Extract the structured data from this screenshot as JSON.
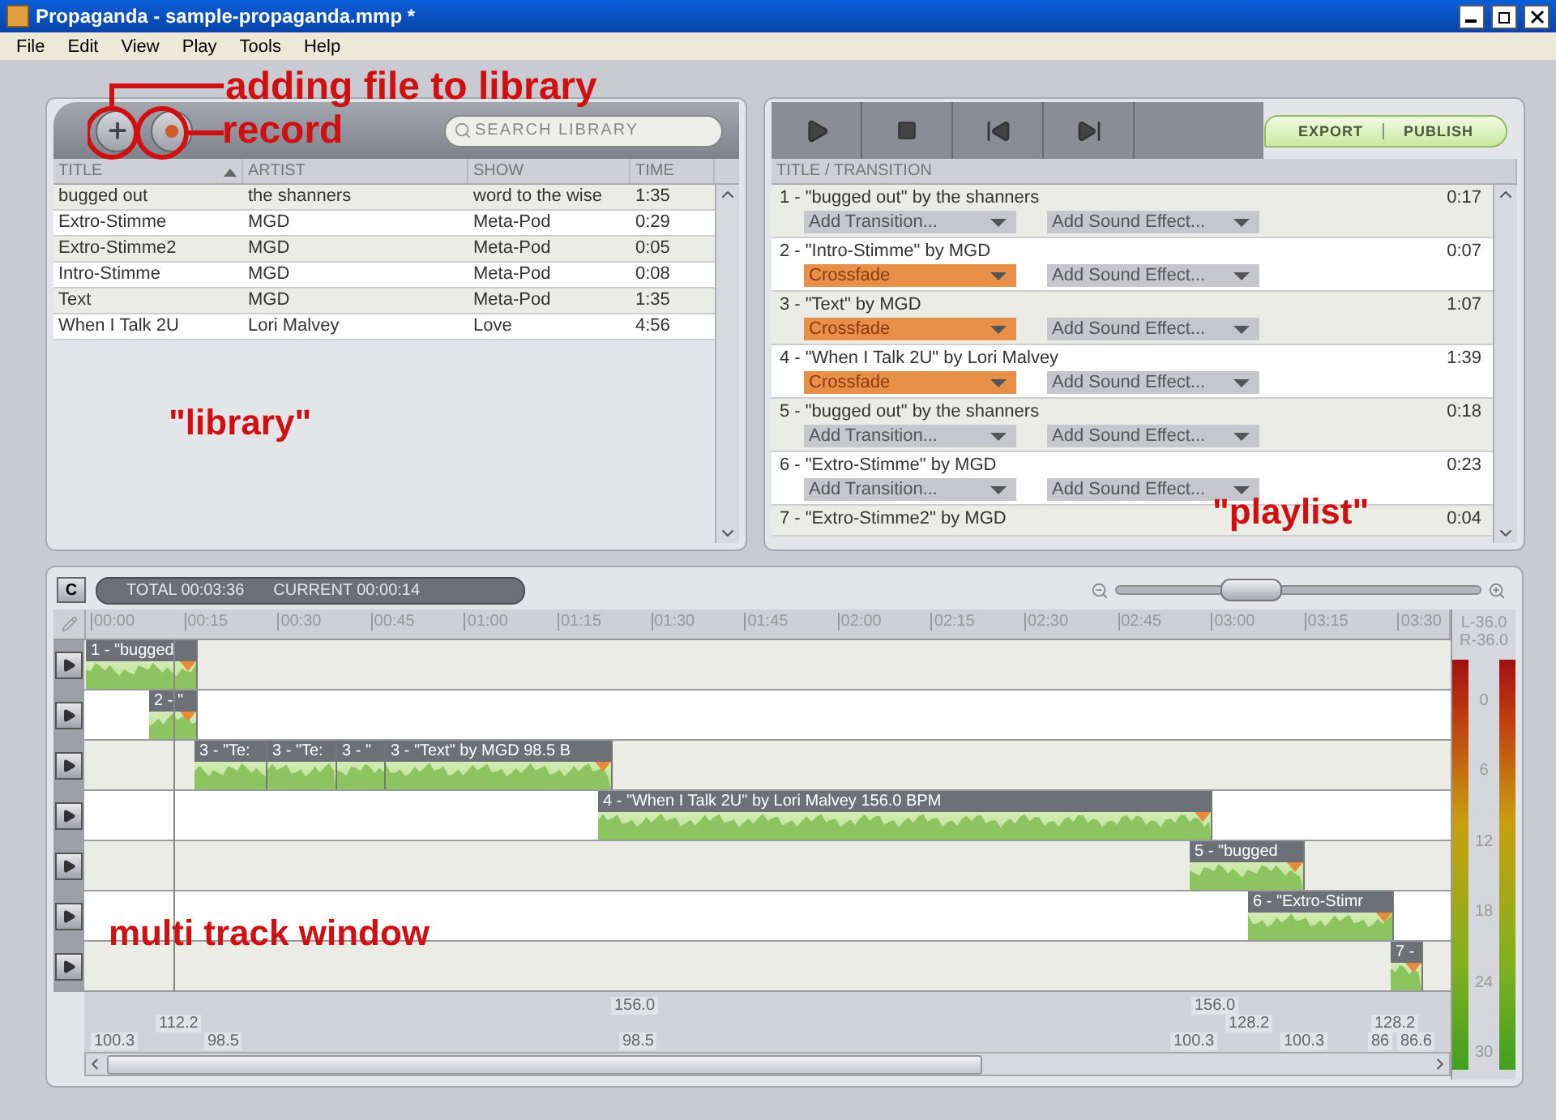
{
  "window": {
    "title": "Propaganda - sample-propaganda.mmp *"
  },
  "menu": [
    "File",
    "Edit",
    "View",
    "Play",
    "Tools",
    "Help"
  ],
  "annotations": [
    {
      "kind": "callout",
      "text": "adding file to library"
    },
    {
      "kind": "callout",
      "text": "record"
    },
    {
      "kind": "label",
      "text": "\"library\""
    },
    {
      "kind": "label",
      "text": "\"playlist\""
    },
    {
      "kind": "label",
      "text": "multi track window"
    }
  ],
  "library": {
    "search": {
      "placeholder": "SEARCH LIBRARY"
    },
    "columns": [
      {
        "label": "TITLE",
        "sorted": true
      },
      {
        "label": "ARTIST",
        "sorted": false
      },
      {
        "label": "SHOW",
        "sorted": false
      },
      {
        "label": "TIME",
        "sorted": false
      }
    ],
    "rows": [
      [
        "bugged out",
        "the shanners",
        "word to the wise",
        "1:35"
      ],
      [
        "Extro-Stimme",
        "MGD",
        "Meta-Pod",
        "0:29"
      ],
      [
        "Extro-Stimme2",
        "MGD",
        "Meta-Pod",
        "0:05"
      ],
      [
        "Intro-Stimme",
        "MGD",
        "Meta-Pod",
        "0:08"
      ],
      [
        "Text",
        "MGD",
        "Meta-Pod",
        "1:35"
      ],
      [
        "When I Talk 2U",
        "Lori Malvey",
        "Love",
        "4:56"
      ]
    ]
  },
  "playlist": {
    "export": "EXPORT",
    "publish": "PUBLISH",
    "column": "TITLE / TRANSITION",
    "items": [
      {
        "title": "1 - \"bugged out\" by the shanners",
        "time": "0:17",
        "transition": {
          "label": "Add Transition...",
          "set": false
        },
        "effect": "Add Sound Effect..."
      },
      {
        "title": "2 - \"Intro-Stimme\" by MGD",
        "time": "0:07",
        "transition": {
          "label": "Crossfade",
          "set": true
        },
        "effect": "Add Sound Effect..."
      },
      {
        "title": "3 - \"Text\" by MGD",
        "time": "1:07",
        "transition": {
          "label": "Crossfade",
          "set": true
        },
        "effect": "Add Sound Effect..."
      },
      {
        "title": "4 - \"When I Talk 2U\" by Lori Malvey",
        "time": "1:39",
        "transition": {
          "label": "Crossfade",
          "set": true
        },
        "effect": "Add Sound Effect..."
      },
      {
        "title": "5 - \"bugged out\" by the shanners",
        "time": "0:18",
        "transition": {
          "label": "Add Transition...",
          "set": false
        },
        "effect": "Add Sound Effect..."
      },
      {
        "title": "6 - \"Extro-Stimme\" by MGD",
        "time": "0:23",
        "transition": {
          "label": "Add Transition...",
          "set": false
        },
        "effect": "Add Sound Effect..."
      },
      {
        "title": "7 - \"Extro-Stimme2\" by MGD",
        "time": "0:04"
      }
    ]
  },
  "timeline": {
    "clear_button": "C",
    "total": "TOTAL 00:03:36",
    "current": "CURRENT 00:00:14",
    "zoom": {
      "level": 0.37
    },
    "ruler": [
      "00:00",
      "00:15",
      "00:30",
      "00:45",
      "01:00",
      "01:15",
      "01:30",
      "01:45",
      "02:00",
      "02:15",
      "02:30",
      "02:45",
      "03:00",
      "03:15",
      "03:30"
    ],
    "tracks": [
      {
        "clips": [
          "1 - \"bugged"
        ]
      },
      {
        "clips": [
          "2 - \""
        ]
      },
      {
        "clips": [
          "3 - \"Te:",
          "3 - \"Te:",
          "3 - \"",
          "3 - \"Text\" by MGD 98.5 B"
        ]
      },
      {
        "clips": [
          "4 - \"When I Talk 2U\" by Lori Malvey 156.0 BPM"
        ]
      },
      {
        "clips": [
          "5 - \"bugged"
        ]
      },
      {
        "clips": [
          "6 - \"Extro-Stimr"
        ]
      },
      {
        "clips": [
          "7 -"
        ]
      }
    ],
    "tempo": [
      "156.0",
      "156.0",
      "112.2",
      "128.2",
      "128.2",
      "100.3",
      "98.5",
      "98.5",
      "100.3",
      "100.3",
      "86",
      "86.6"
    ],
    "meter": {
      "left": "L-36.0",
      "right": "R-36.0",
      "scale": [
        "0",
        "6",
        "12",
        "18",
        "24",
        "30"
      ],
      "channels": [
        {
          "level": 1
        },
        {
          "level": 1
        }
      ]
    }
  }
}
